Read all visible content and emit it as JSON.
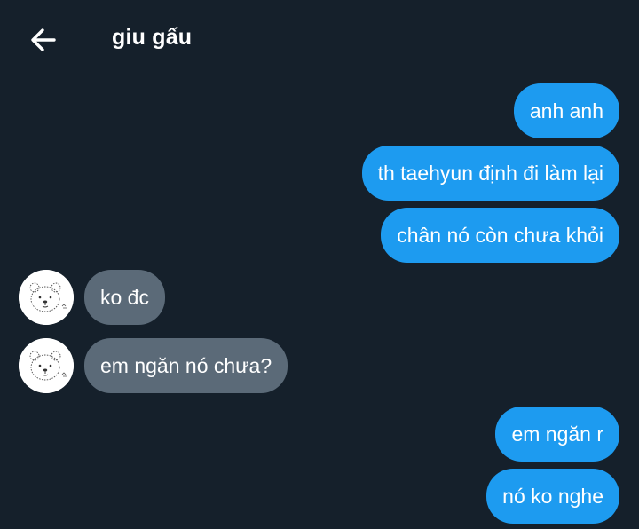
{
  "header": {
    "title": "giu gấu",
    "back_icon": "arrow-left-icon"
  },
  "conversation": {
    "messages": [
      {
        "direction": "sent",
        "text": "anh anh"
      },
      {
        "direction": "sent",
        "text": "th taehyun định đi làm lại"
      },
      {
        "direction": "sent",
        "text": "chân nó còn chưa khỏi"
      },
      {
        "direction": "received",
        "text": "ko đc"
      },
      {
        "direction": "received",
        "text": "em ngăn nó chưa?"
      },
      {
        "direction": "sent",
        "text": "em ngăn r"
      },
      {
        "direction": "sent",
        "text": "nó ko nghe"
      }
    ],
    "avatar_icon": "bear-avatar-icon"
  },
  "colors": {
    "background": "#15202b",
    "sent_bubble": "#1d9bf0",
    "received_bubble": "#5b6a78",
    "text": "#ffffff"
  }
}
